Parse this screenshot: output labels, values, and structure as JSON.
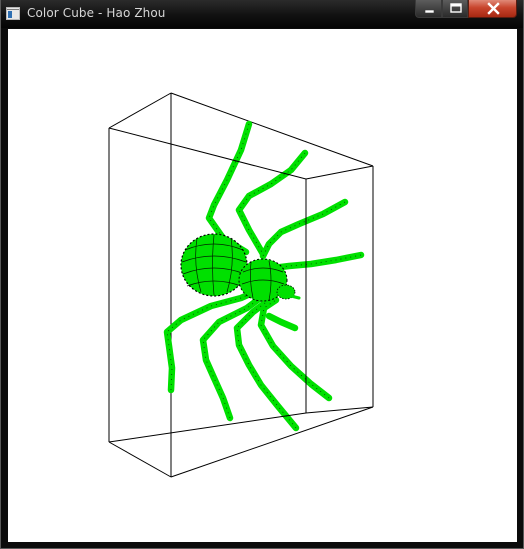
{
  "window": {
    "title": "Color Cube - Hao Zhou",
    "icon": "app-window-icon",
    "buttons": {
      "minimize": "minimize-icon",
      "maximize": "maximize-icon",
      "close": "close-icon"
    }
  },
  "scene": {
    "background_color": "#ffffff",
    "box_edge_color": "#000000",
    "model_color": "#00e000",
    "model_shade_color": "#000000"
  }
}
